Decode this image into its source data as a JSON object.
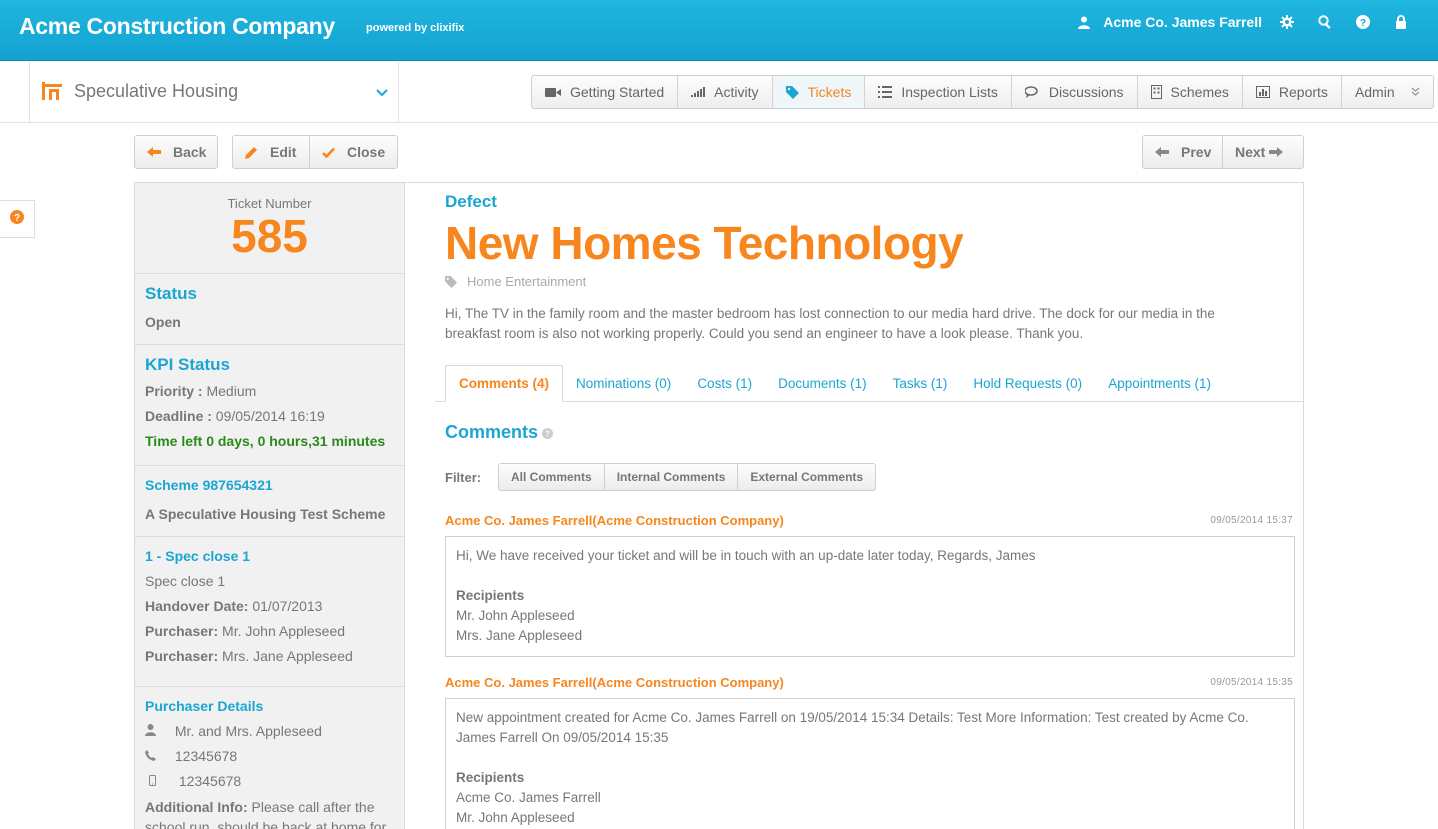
{
  "header": {
    "company": "Acme Construction Company",
    "powered_by": "powered by clixifix",
    "user": "Acme Co. James Farrell"
  },
  "project": {
    "name": "Speculative Housing"
  },
  "nav_tabs": [
    {
      "label": "Getting Started",
      "icon": "video-camera-icon"
    },
    {
      "label": "Activity",
      "icon": "signal-icon"
    },
    {
      "label": "Tickets",
      "icon": "tag-icon",
      "active": true
    },
    {
      "label": "Inspection Lists",
      "icon": "list-icon"
    },
    {
      "label": "Discussions",
      "icon": "chat-icon"
    },
    {
      "label": "Schemes",
      "icon": "building-icon"
    },
    {
      "label": "Reports",
      "icon": "bar-chart-icon"
    },
    {
      "label": "Admin",
      "icon": "chevron-down-icon"
    }
  ],
  "actions": {
    "back": "Back",
    "edit": "Edit",
    "close": "Close",
    "prev": "Prev",
    "next": "Next"
  },
  "ticket": {
    "number_label": "Ticket Number",
    "number": "585",
    "status_heading": "Status",
    "status": "Open",
    "kpi_heading": "KPI Status",
    "priority_label": "Priority :",
    "priority": "Medium",
    "deadline_label": "Deadline :",
    "deadline": "09/05/2014 16:19",
    "time_left": "Time left 0 days, 0 hours,31 minutes",
    "scheme_link": "Scheme 987654321",
    "scheme_name": "A Speculative Housing Test Scheme",
    "plot_link": "1 - Spec close 1",
    "plot_name": "Spec close 1",
    "handover_label": "Handover Date:",
    "handover": "01/07/2013",
    "purchaser_label": "Purchaser:",
    "purchaser1": "Mr. John Appleseed",
    "purchaser2": "Mrs. Jane Appleseed",
    "purchaser_details_heading": "Purchaser Details",
    "contact_name": "Mr. and Mrs. Appleseed",
    "phone": "12345678",
    "mobile": "12345678",
    "additional_label": "Additional Info:",
    "additional_text": "Please call after the school run, should be back at home for"
  },
  "defect": {
    "type": "Defect",
    "title": "New Homes Technology",
    "category": "Home Entertainment",
    "description": "Hi, The TV in the family room and the master bedroom has lost connection to our media hard drive. The dock for our media in the breakfast room is also not working properly. Could you send an engineer to have a look please. Thank you."
  },
  "detail_tabs": [
    "Comments (4)",
    "Nominations (0)",
    "Costs (1)",
    "Documents (1)",
    "Tasks (1)",
    "Hold Requests (0)",
    "Appointments (1)"
  ],
  "comments_section": {
    "heading": "Comments",
    "filter_label": "Filter:",
    "filters": [
      "All Comments",
      "Internal Comments",
      "External Comments"
    ]
  },
  "comments": [
    {
      "author": "Acme Co. James Farrell(Acme Construction Company)",
      "time": "09/05/2014 15:37",
      "text": "Hi, We have received your ticket and will be in touch with an up-date later today, Regards, James",
      "recipients_label": "Recipients",
      "recipients": [
        "Mr. John Appleseed",
        "Mrs. Jane Appleseed"
      ]
    },
    {
      "author": "Acme Co. James Farrell(Acme Construction Company)",
      "time": "09/05/2014 15:35",
      "text": "New appointment created for Acme Co. James Farrell on 19/05/2014 15:34 Details: Test More Information: Test created by Acme Co. James Farrell On 09/05/2014 15:35",
      "recipients_label": "Recipients",
      "recipients": [
        "Acme Co. James Farrell",
        "Mr. John Appleseed"
      ]
    }
  ],
  "colors": {
    "header_blue": "#1ba6d2",
    "accent_orange": "#f7861f",
    "green": "#2a8a1a"
  }
}
